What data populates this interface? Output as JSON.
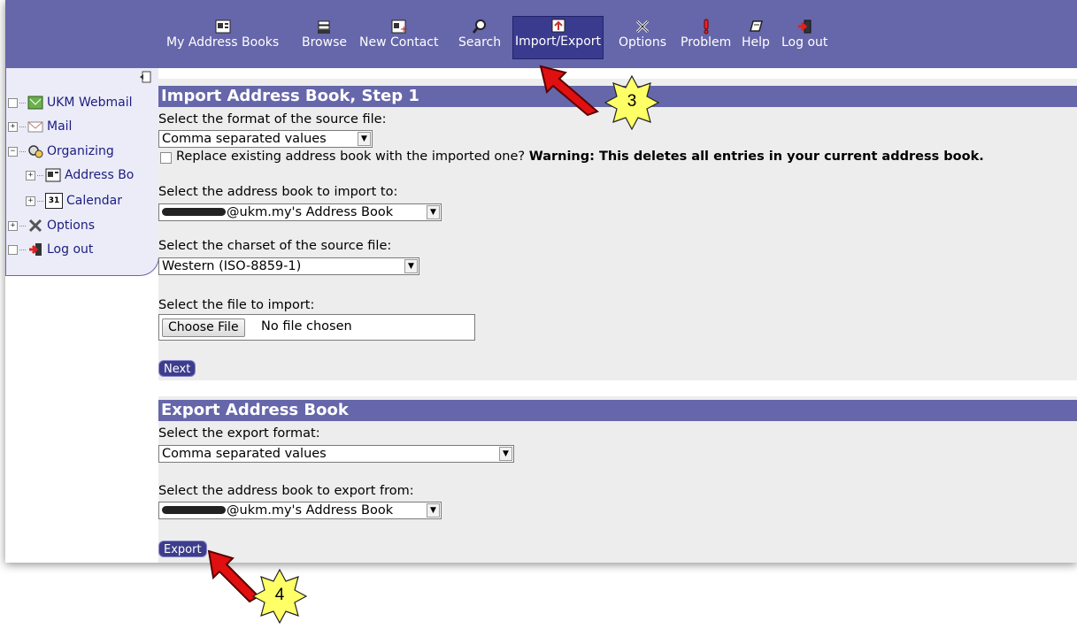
{
  "nav": {
    "items": [
      {
        "label": "My Address Books",
        "icon": "address-book-icon"
      },
      {
        "label": "Browse",
        "icon": "browse-icon"
      },
      {
        "label": "New Contact",
        "icon": "new-contact-icon"
      },
      {
        "label": "Search",
        "icon": "search-icon"
      },
      {
        "label": "Import/Export",
        "icon": "import-export-icon",
        "active": true
      },
      {
        "label": "Options",
        "icon": "options-icon"
      },
      {
        "label": "Problem",
        "icon": "problem-icon"
      },
      {
        "label": "Help",
        "icon": "help-icon"
      },
      {
        "label": "Log out",
        "icon": "logout-icon"
      }
    ]
  },
  "sidebar": {
    "items": [
      {
        "label": "UKM Webmail",
        "expander": "",
        "icon": "webmail-icon"
      },
      {
        "label": "Mail",
        "expander": "+",
        "icon": "mail-icon"
      },
      {
        "label": "Organizing",
        "expander": "−",
        "icon": "organizing-icon"
      },
      {
        "label": "Address Bo",
        "expander": "+",
        "icon": "address-book-icon"
      },
      {
        "label": "Calendar",
        "expander": "+",
        "icon": "calendar-icon",
        "badge": "31"
      },
      {
        "label": "Options",
        "expander": "+",
        "icon": "options-icon"
      },
      {
        "label": "Log out",
        "expander": "",
        "icon": "logout-icon"
      }
    ]
  },
  "import": {
    "header": "Import Address Book, Step 1",
    "format_label": "Select the format of the source file:",
    "format_value": "Comma separated values",
    "replace_label": "Replace existing address book with the imported one?",
    "replace_warning": "Warning: This deletes all entries in your current address book.",
    "target_label": "Select the address book to import to:",
    "target_value": "@ukm.my's Address Book",
    "charset_label": "Select the charset of the source file:",
    "charset_value": "Western (ISO-8859-1)",
    "file_label": "Select the file to import:",
    "file_button": "Choose File",
    "file_status": "No file chosen",
    "next_button": "Next"
  },
  "export": {
    "header": "Export Address Book",
    "format_label": "Select the export format:",
    "format_value": "Comma separated values",
    "source_label": "Select the address book to export from:",
    "source_value": "@ukm.my's Address Book",
    "export_button": "Export"
  },
  "callouts": {
    "step3": "3",
    "step4": "4",
    "color_arrow": "#e01010",
    "color_star": "#ffff66"
  },
  "colors": {
    "bar": "#6666aa",
    "active_nav": "#3a3a8e",
    "link": "#1c1c80",
    "panel": "#ededed"
  }
}
